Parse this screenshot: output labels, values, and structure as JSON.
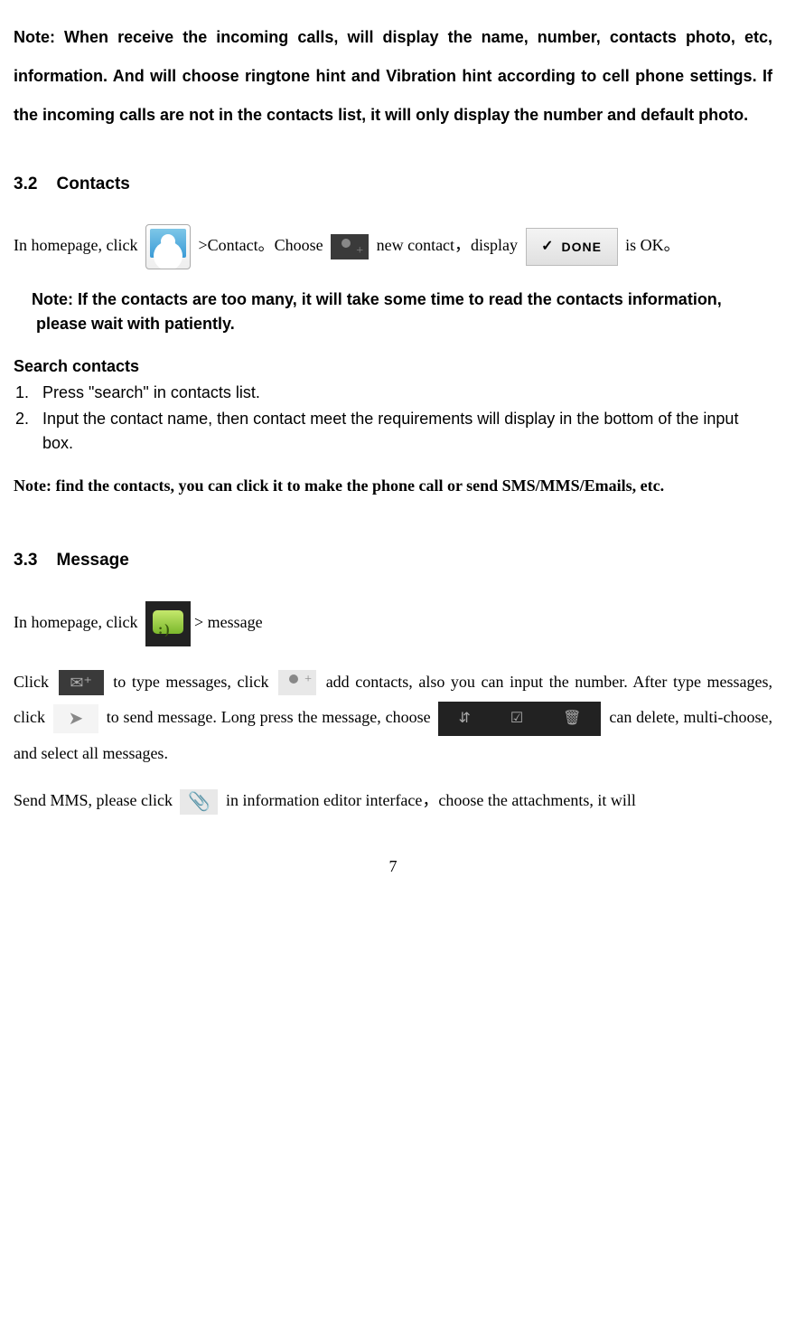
{
  "notes": {
    "incoming_calls": "Note: When receive the incoming calls, will display the name, number, contacts photo, etc, information. And will choose ringtone hint and Vibration hint according to cell phone settings. If the incoming calls are not in the contacts list, it will only display the number and default photo.",
    "contacts_wait": "Note: If the contacts are too many, it will take some time to read the contacts information, please wait with patiently.",
    "find_contacts": "Note: find the contacts, you can click it to make the phone call or send SMS/MMS/Emails, etc."
  },
  "section32": {
    "num": "3.2",
    "title": "Contacts",
    "text1": "In homepage, click",
    "text2": ">Contact。Choose",
    "text3": "new contact，display",
    "text4": "is OK。",
    "done_label": "DONE"
  },
  "search": {
    "heading": "Search contacts",
    "items": [
      "Press \"search\" in contacts list.",
      "Input the contact name, then contact meet the requirements will display in the bottom of the input box."
    ]
  },
  "section33": {
    "num": "3.3",
    "title": "Message",
    "text1": "In homepage, click",
    "text2": "> message",
    "para2a": "Click",
    "para2b": "to type messages, click",
    "para2c": "add contacts, also you can input the number. After type messages, click",
    "para2d": "to send message. Long press the message, choose",
    "para2e": "can delete, multi-choose, and select all messages.",
    "para3a": "Send MMS, please click",
    "para3b": "in information editor interface，choose the attachments, it will"
  },
  "page_number": "7"
}
